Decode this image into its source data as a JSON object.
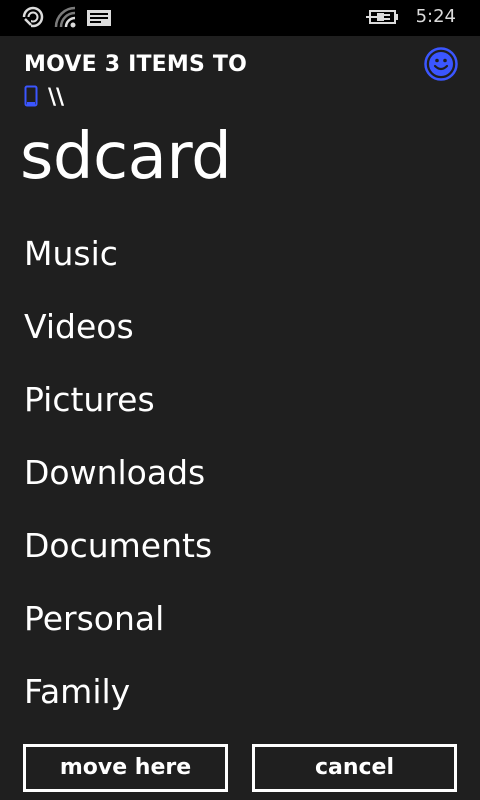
{
  "status_bar": {
    "time": "5:24",
    "icons": [
      "sync-icon",
      "wifi-signal-icon",
      "message-icon",
      "battery-charging-icon"
    ]
  },
  "header": {
    "title": "MOVE 3 ITEMS TO",
    "feedback_icon": "smiley-icon",
    "accent_color": "#3b56ff"
  },
  "path": {
    "device_icon": "phone-icon",
    "separator": "\\\\"
  },
  "folder": {
    "title": "sdcard"
  },
  "folders": [
    {
      "label": "Music"
    },
    {
      "label": "Videos"
    },
    {
      "label": "Pictures"
    },
    {
      "label": "Downloads"
    },
    {
      "label": "Documents"
    },
    {
      "label": "Personal"
    },
    {
      "label": "Family"
    }
  ],
  "actions": {
    "move_here_label": "move here",
    "cancel_label": "cancel"
  }
}
